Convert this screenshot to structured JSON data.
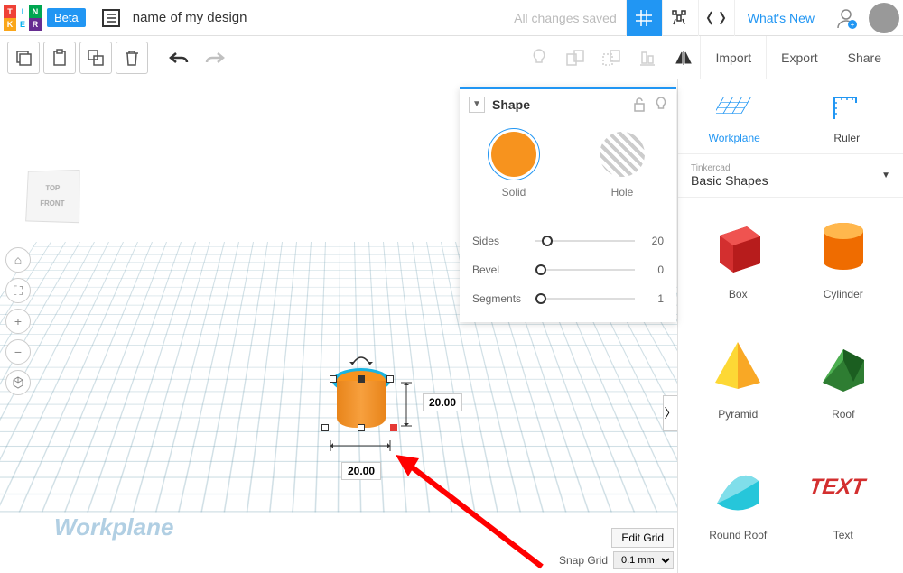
{
  "header": {
    "beta": "Beta",
    "design_name": "name of my design",
    "save_status": "All changes saved",
    "whats_new": "What's New"
  },
  "toolbar": {
    "import": "Import",
    "export": "Export",
    "share": "Share"
  },
  "nav_cube": {
    "top": "TOP",
    "front": "FRONT"
  },
  "panel": {
    "title": "Shape",
    "solid": "Solid",
    "hole": "Hole",
    "params": {
      "sides": {
        "label": "Sides",
        "value": "20"
      },
      "bevel": {
        "label": "Bevel",
        "value": "0"
      },
      "segments": {
        "label": "Segments",
        "value": "1"
      }
    }
  },
  "dims": {
    "width": "20.00",
    "height": "20.00"
  },
  "sidebar": {
    "workplane": "Workplane",
    "ruler": "Ruler",
    "category_sup": "Tinkercad",
    "category": "Basic Shapes",
    "shapes": {
      "box": "Box",
      "cylinder": "Cylinder",
      "pyramid": "Pyramid",
      "roof": "Roof",
      "round_roof": "Round Roof",
      "text": "Text"
    }
  },
  "bottom": {
    "edit_grid": "Edit Grid",
    "snap_grid": "Snap Grid",
    "snap_value": "0.1 mm"
  },
  "watermark": "Workplane"
}
